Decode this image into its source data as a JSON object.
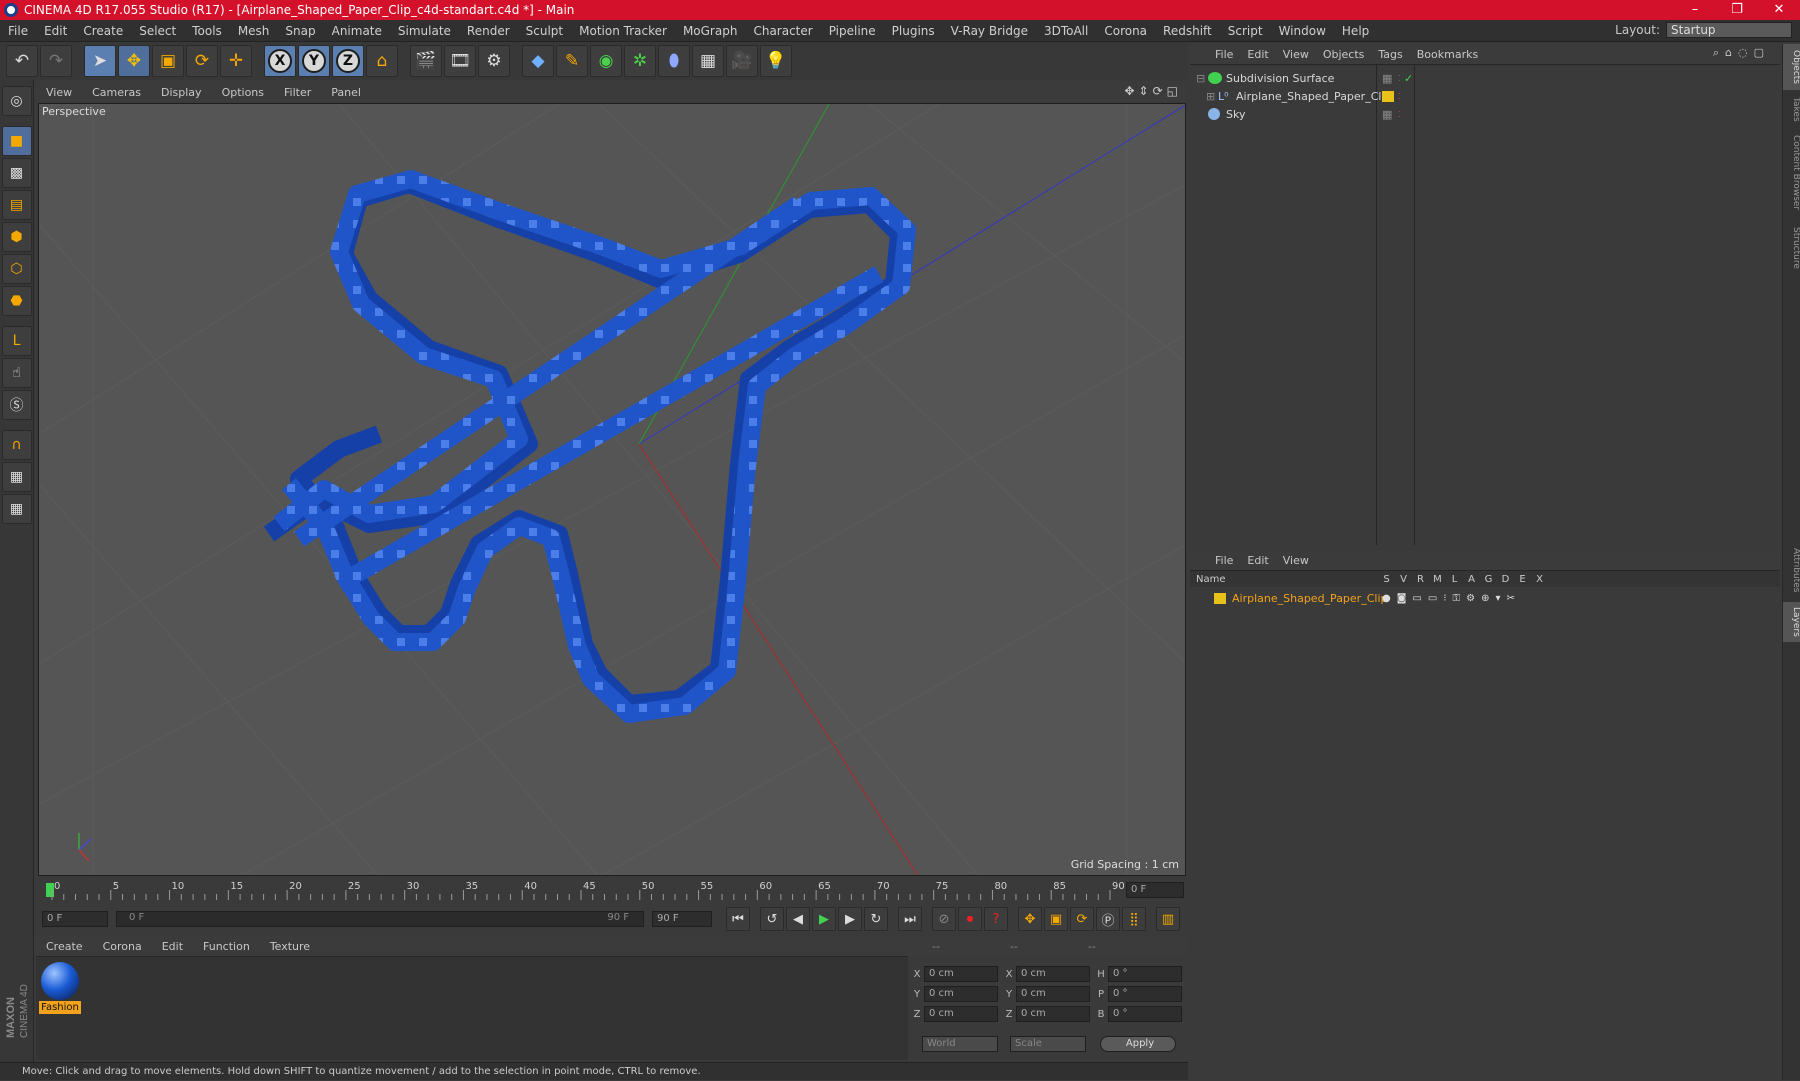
{
  "window": {
    "title": "CINEMA 4D R17.055 Studio (R17) - [Airplane_Shaped_Paper_Clip_c4d-standart.c4d *] - Main",
    "minimize": "–",
    "maximize": "❐",
    "close": "✕"
  },
  "menu": [
    "File",
    "Edit",
    "Create",
    "Select",
    "Tools",
    "Mesh",
    "Snap",
    "Animate",
    "Simulate",
    "Render",
    "Sculpt",
    "Motion Tracker",
    "MoGraph",
    "Character",
    "Pipeline",
    "Plugins",
    "V-Ray Bridge",
    "3DToAll",
    "Corona",
    "Redshift",
    "Script",
    "Window",
    "Help"
  ],
  "layout": {
    "label": "Layout:",
    "value": "Startup"
  },
  "viewport": {
    "menu": [
      "View",
      "Cameras",
      "Display",
      "Options",
      "Filter",
      "Panel"
    ],
    "label": "Perspective",
    "grid_spacing": "Grid Spacing : 1 cm"
  },
  "timeline": {
    "ticks": [
      "0",
      "5",
      "10",
      "15",
      "20",
      "25",
      "30",
      "35",
      "40",
      "45",
      "50",
      "55",
      "60",
      "65",
      "70",
      "75",
      "80",
      "85",
      "90"
    ],
    "current_frame": "0 F",
    "start": "0 F",
    "range_start": "0 F",
    "range_end": "90 F",
    "end": "90 F"
  },
  "material": {
    "menu": [
      "Create",
      "Corona",
      "Edit",
      "Function",
      "Texture"
    ],
    "items": [
      {
        "name": "Fashion"
      }
    ]
  },
  "coords": {
    "headers": [
      "--",
      "--",
      "--"
    ],
    "rows": [
      {
        "a1": "X",
        "v1": "0 cm",
        "a2": "X",
        "v2": "0 cm",
        "a3": "H",
        "v3": "0 °"
      },
      {
        "a1": "Y",
        "v1": "0 cm",
        "a2": "Y",
        "v2": "0 cm",
        "a3": "P",
        "v3": "0 °"
      },
      {
        "a1": "Z",
        "v1": "0 cm",
        "a2": "Z",
        "v2": "0 cm",
        "a3": "B",
        "v3": "0 °"
      }
    ],
    "space": "World",
    "mode": "Scale",
    "apply": "Apply"
  },
  "objects": {
    "menu": [
      "File",
      "Edit",
      "View",
      "Objects",
      "Tags",
      "Bookmarks"
    ],
    "items": [
      {
        "name": "Subdivision Surface"
      },
      {
        "name": "Airplane_Shaped_Paper_Clip"
      },
      {
        "name": "Sky"
      }
    ]
  },
  "layers": {
    "menu": [
      "File",
      "Edit",
      "View"
    ],
    "columns": [
      "Name",
      "S",
      "V",
      "R",
      "M",
      "L",
      "A",
      "G",
      "D",
      "E",
      "X"
    ],
    "items": [
      {
        "name": "Airplane_Shaped_Paper_Clip"
      }
    ]
  },
  "side_tabs": [
    "Objects",
    "Takes",
    "Content Browser",
    "Structure",
    "Attributes",
    "Layers"
  ],
  "status": "Move: Click and drag to move elements. Hold down SHIFT to quantize movement / add to the selection in point mode, CTRL to remove.",
  "brand": "MAXON CINEMA 4D",
  "colors": {
    "accent": "#d4112b",
    "clip_blue": "#1f55c8",
    "layer_yellow": "#e8c21a",
    "material_orange": "#f3a31b"
  }
}
